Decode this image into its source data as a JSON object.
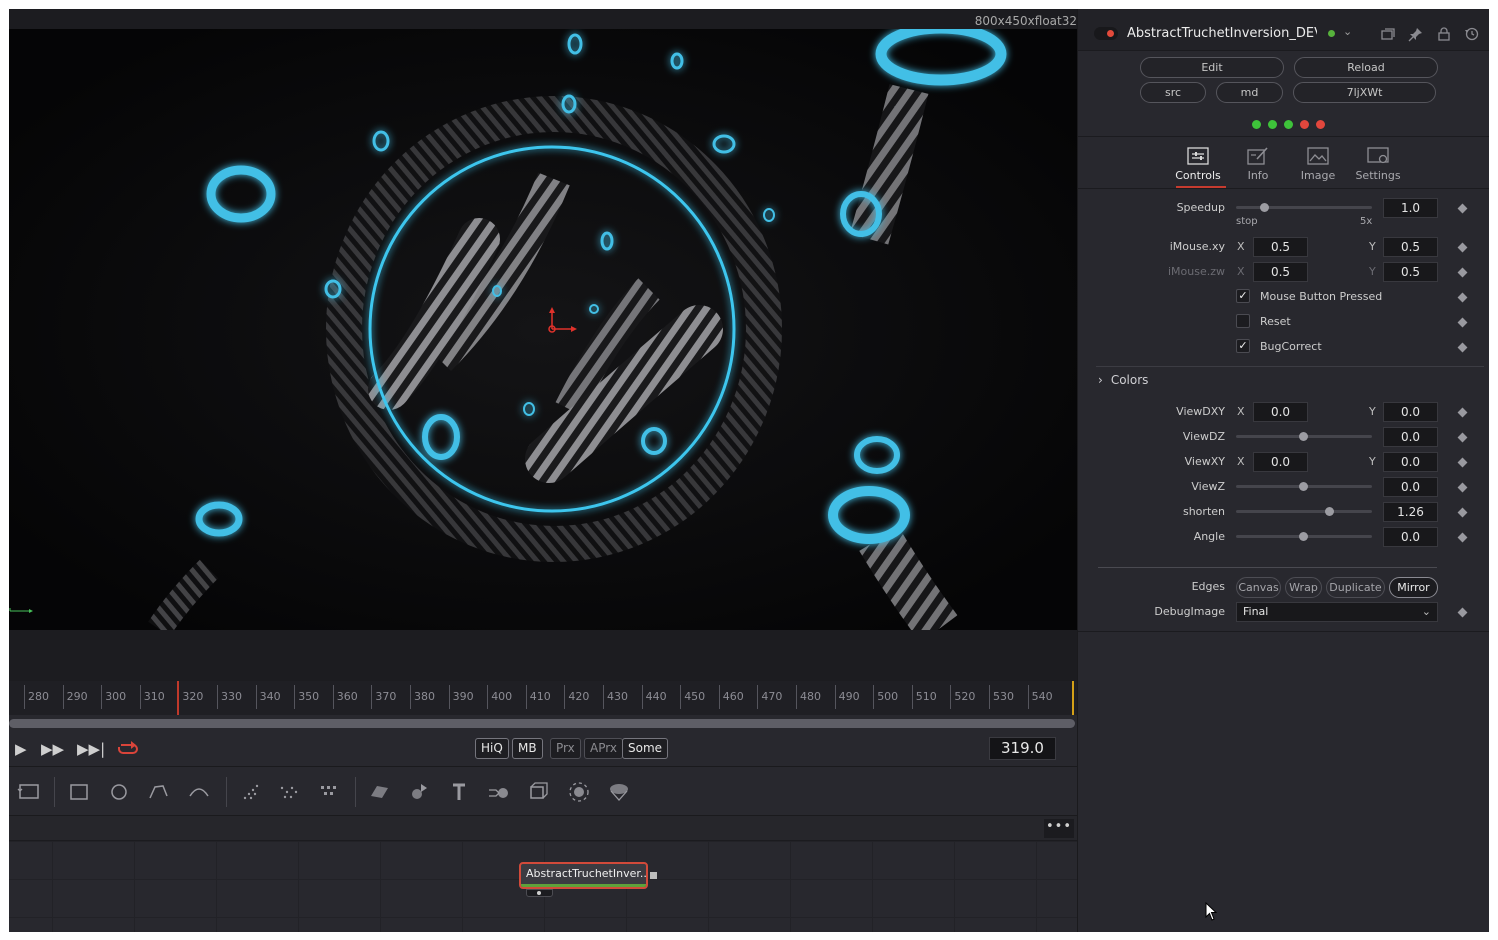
{
  "viewer": {
    "resolution_label": "800x450xfloat32"
  },
  "timeline": {
    "ticks": [
      "280",
      "290",
      "300",
      "310",
      "320",
      "330",
      "340",
      "350",
      "360",
      "370",
      "380",
      "390",
      "400",
      "410",
      "420",
      "430",
      "440",
      "450",
      "460",
      "470",
      "480",
      "490",
      "500",
      "510",
      "520",
      "530",
      "540"
    ],
    "current_frame": "319.0"
  },
  "transport": {
    "quality_buttons": [
      {
        "label": "HiQ",
        "active": true
      },
      {
        "label": "MB",
        "active": true
      },
      {
        "label": "Prx",
        "active": false
      },
      {
        "label": "APrx",
        "active": false
      },
      {
        "label": "Some",
        "active": true
      }
    ]
  },
  "toolbar": {
    "tools": [
      "background-icon",
      "rectangle-mask-icon",
      "ellipse-mask-icon",
      "polygon-mask-icon",
      "bspline-mask-icon",
      "particle-emitter-icon",
      "particle-render-icon",
      "particle-style-icon",
      "image-plane-3d-icon",
      "shape-3d-icon",
      "text-3d-icon",
      "merge-3d-icon",
      "camera-3d-icon",
      "renderer-3d-icon",
      "fbx-loader-icon"
    ]
  },
  "nodegraph": {
    "more_label": "•••",
    "node_label": "AbstractTruchetInver..."
  },
  "inspector": {
    "title": "AbstractTruchetInversion_DEV'",
    "buttons": {
      "edit": "Edit",
      "reload": "Reload",
      "src": "src",
      "md": "md",
      "hash": "7ljXWt"
    },
    "status_dots": [
      "#3ec23a",
      "#3ec23a",
      "#3ec23a",
      "#e2473d",
      "#e2473d"
    ],
    "tabs": [
      {
        "label": "Controls",
        "icon": "sliders-icon"
      },
      {
        "label": "Info",
        "icon": "info-edit-icon"
      },
      {
        "label": "Image",
        "icon": "image-icon"
      },
      {
        "label": "Settings",
        "icon": "settings-icon"
      }
    ],
    "speedup": {
      "label": "Speedup",
      "value": "1.0",
      "min_label": "stop",
      "max_label": "5x"
    },
    "imouse_xy": {
      "label": "iMouse.xy",
      "x_label": "X",
      "x": "0.5",
      "y_label": "Y",
      "y": "0.5"
    },
    "imouse_zw": {
      "label": "iMouse.zw",
      "x_label": "X",
      "x": "0.5",
      "y_label": "Y",
      "y": "0.5"
    },
    "mouse_button_pressed": {
      "label": "Mouse Button Pressed",
      "checked": true
    },
    "reset": {
      "label": "Reset",
      "checked": false
    },
    "bugcorrect": {
      "label": "BugCorrect",
      "checked": true
    },
    "colors_group": "Colors",
    "viewdxy": {
      "label": "ViewDXY",
      "x_label": "X",
      "x": "0.0",
      "y_label": "Y",
      "y": "0.0"
    },
    "viewdz": {
      "label": "ViewDZ",
      "value": "0.0"
    },
    "viewxy": {
      "label": "ViewXY",
      "x_label": "X",
      "x": "0.0",
      "y_label": "Y",
      "y": "0.0"
    },
    "viewz": {
      "label": "ViewZ",
      "value": "0.0"
    },
    "shorten": {
      "label": "shorten",
      "value": "1.26"
    },
    "angle": {
      "label": "Angle",
      "value": "0.0"
    },
    "edges": {
      "label": "Edges",
      "options": [
        "Canvas",
        "Wrap",
        "Duplicate",
        "Mirror"
      ],
      "selected": "Mirror"
    },
    "debug_image": {
      "label": "DebugImage",
      "value": "Final"
    }
  }
}
